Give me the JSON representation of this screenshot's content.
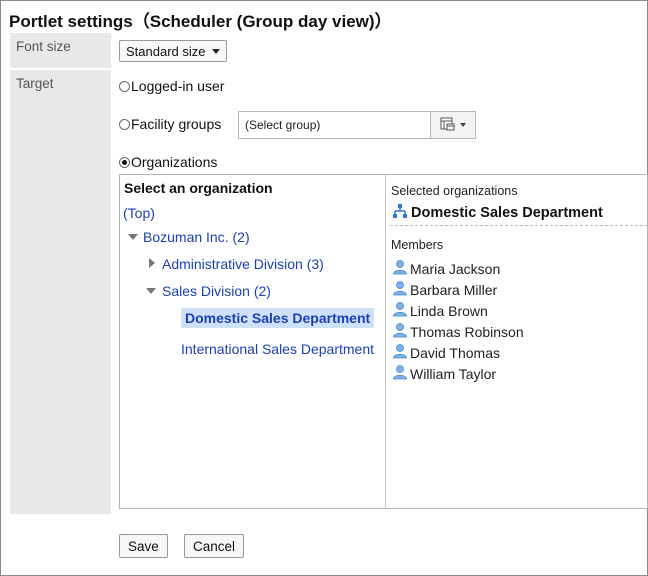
{
  "page": {
    "title": "Portlet settings（Scheduler (Group day view)）"
  },
  "font_size": {
    "label": "Font size",
    "selected": "Standard size"
  },
  "target": {
    "label": "Target",
    "options": {
      "logged_in": "Logged-in user",
      "facility_groups": "Facility groups",
      "organizations": "Organizations"
    },
    "selected_option": "Organizations",
    "group_select_placeholder": "(Select group)"
  },
  "org_picker": {
    "title": "Select an organization",
    "top_link": "(Top)",
    "tree": {
      "root": "Bozuman Inc. (2)",
      "admin": "Administrative Division (3)",
      "sales": "Sales Division (2)",
      "domestic": "Domestic Sales Department",
      "international": "International Sales Department"
    },
    "selected_label": "Selected organizations",
    "selected_org": "Domestic Sales Department",
    "members_label": "Members",
    "members": [
      "Maria Jackson",
      "Barbara Miller",
      "Linda Brown",
      "Thomas Robinson",
      "David Thomas",
      "William Taylor"
    ]
  },
  "buttons": {
    "save": "Save",
    "cancel": "Cancel"
  },
  "colors": {
    "link": "#1a3fb5",
    "selection_bg": "#cfe1f8",
    "label_bg": "#e8e8e8"
  }
}
